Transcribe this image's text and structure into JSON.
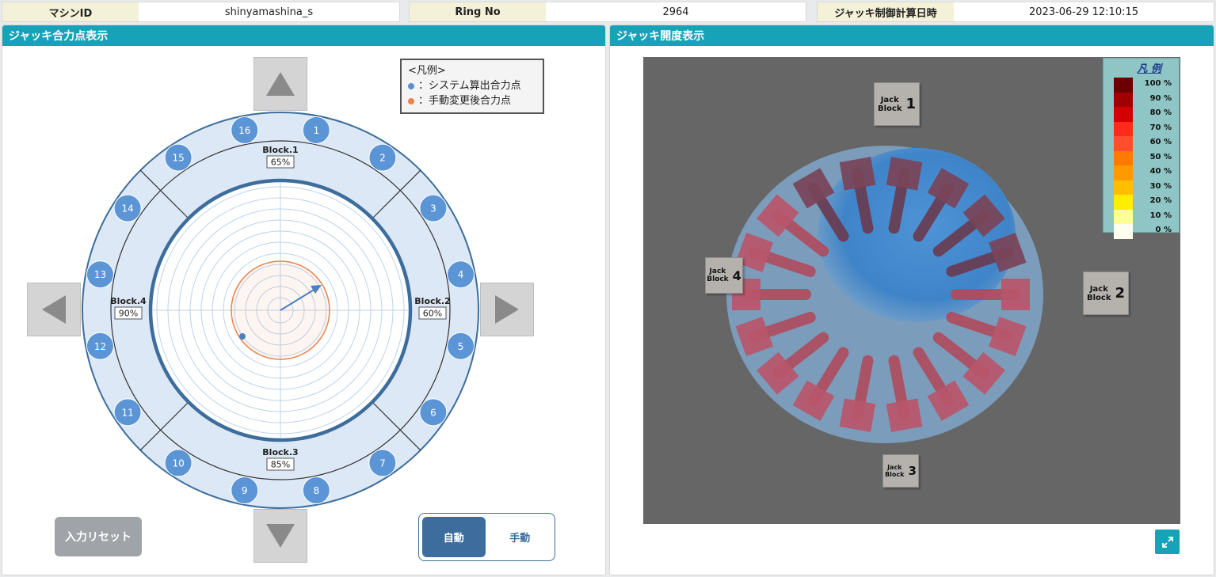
{
  "header": {
    "machine_id_label": "マシンID",
    "machine_id_value": "shinyamashina_s",
    "ring_no_label": "Ring No",
    "ring_no_value": "2964",
    "calc_time_label": "ジャッキ制御計算日時",
    "calc_time_value": "2023-06-29 12:10:15"
  },
  "left_panel": {
    "title": "ジャッキ合力点表示",
    "legend": {
      "title": "<凡例>",
      "items": [
        {
          "label": "：システム算出合力点",
          "color": "#5b8fcc"
        },
        {
          "label": "：手動変更後合力点",
          "color": "#e8844a"
        }
      ]
    },
    "blocks": [
      {
        "name": "Block.1",
        "value": "65%"
      },
      {
        "name": "Block.2",
        "value": "60%"
      },
      {
        "name": "Block.3",
        "value": "85%"
      },
      {
        "name": "Block.4",
        "value": "90%"
      }
    ],
    "jacks": [
      "1",
      "2",
      "3",
      "4",
      "5",
      "6",
      "7",
      "8",
      "9",
      "10",
      "11",
      "12",
      "13",
      "14",
      "15",
      "16"
    ],
    "reset_label": "入力リセット",
    "mode": {
      "auto_label": "自動",
      "manual_label": "手動",
      "selected": "自動"
    },
    "colors": {
      "ring_fill": "#dce8f5",
      "jack_circle": "#5b95d6",
      "ring_stroke": "#3c6d9c"
    }
  },
  "right_panel": {
    "title": "ジャッキ開度表示",
    "jack_blocks": [
      {
        "line1": "Jack",
        "line2": "Block",
        "num": "1"
      },
      {
        "line1": "Jack",
        "line2": "Block",
        "num": "2"
      },
      {
        "line1": "Jack",
        "line2": "Block",
        "num": "3"
      },
      {
        "line1": "Jack",
        "line2": "Block",
        "num": "4"
      }
    ],
    "colorbar": {
      "title": "凡 例",
      "levels": [
        {
          "label": "100 %",
          "color": "#6b0000"
        },
        {
          "label": "90 %",
          "color": "#a10000"
        },
        {
          "label": "80 %",
          "color": "#d40000"
        },
        {
          "label": "70 %",
          "color": "#ff2a1a"
        },
        {
          "label": "60 %",
          "color": "#ff4d2e"
        },
        {
          "label": "50 %",
          "color": "#ff7a00"
        },
        {
          "label": "40 %",
          "color": "#ff9900"
        },
        {
          "label": "30 %",
          "color": "#ffbf00"
        },
        {
          "label": "20 %",
          "color": "#ffee00"
        },
        {
          "label": "10 %",
          "color": "#ffff99"
        },
        {
          "label": "0 %",
          "color": "#fffff0"
        }
      ]
    }
  }
}
